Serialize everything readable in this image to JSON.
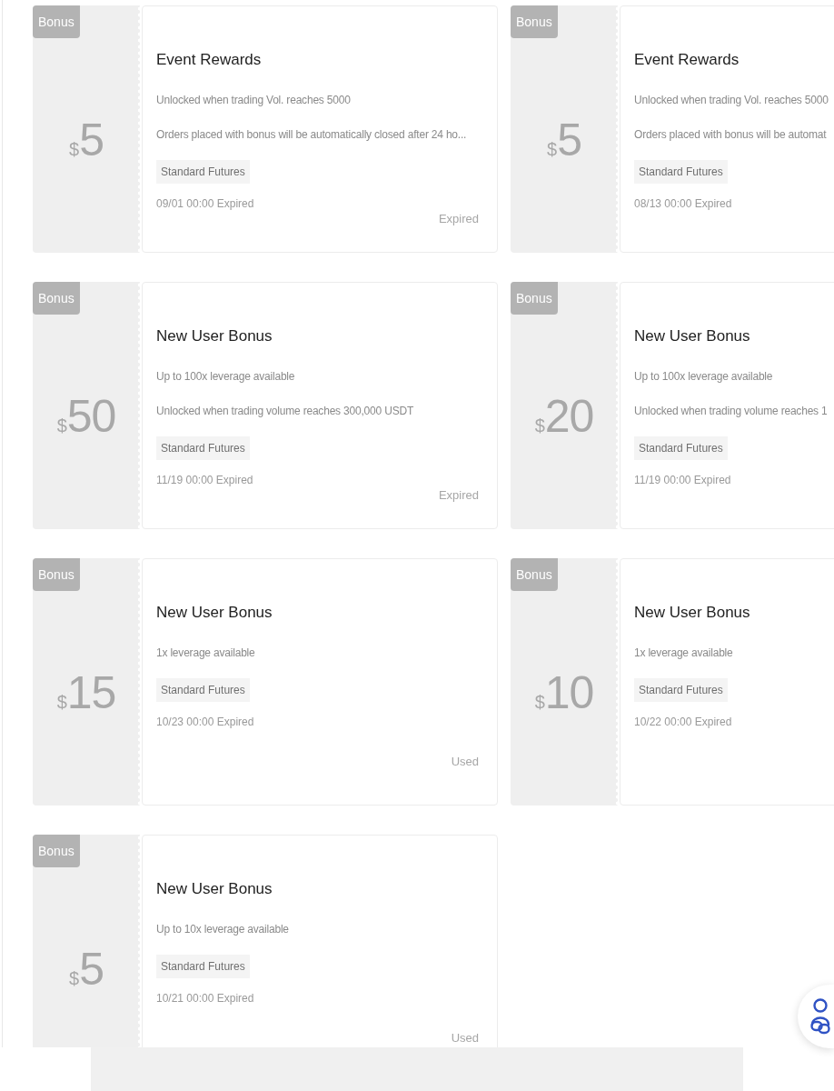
{
  "coupons": [
    {
      "badge": "Bonus",
      "currency": "$",
      "amount": "5",
      "title": "Event Rewards",
      "conditions": [
        "Unlocked when trading Vol. reaches 5000",
        "Orders placed with bonus will be automatically closed after 24 ho..."
      ],
      "tag": "Standard Futures",
      "expiry": "09/01 00:00 Expired",
      "status": "Expired"
    },
    {
      "badge": "Bonus",
      "currency": "$",
      "amount": "5",
      "title": "Event Rewards",
      "conditions": [
        "Unlocked when trading Vol. reaches 5000",
        "Orders placed with bonus will be automat"
      ],
      "tag": "Standard Futures",
      "expiry": "08/13 00:00 Expired"
    },
    {
      "badge": "Bonus",
      "currency": "$",
      "amount": "50",
      "title": "New User Bonus",
      "conditions": [
        "Up to 100x leverage available",
        "Unlocked when trading volume reaches 300,000 USDT"
      ],
      "tag": "Standard Futures",
      "expiry": "11/19 00:00 Expired",
      "status": "Expired"
    },
    {
      "badge": "Bonus",
      "currency": "$",
      "amount": "20",
      "title": "New User Bonus",
      "conditions": [
        "Up to 100x leverage available",
        "Unlocked when trading volume reaches 1"
      ],
      "tag": "Standard Futures",
      "expiry": "11/19 00:00 Expired"
    },
    {
      "badge": "Bonus",
      "currency": "$",
      "amount": "15",
      "title": "New User Bonus",
      "conditions": [
        "1x leverage available"
      ],
      "tag": "Standard Futures",
      "expiry": "10/23 00:00 Expired",
      "status": "Used"
    },
    {
      "badge": "Bonus",
      "currency": "$",
      "amount": "10",
      "title": "New User Bonus",
      "conditions": [
        "1x leverage available"
      ],
      "tag": "Standard Futures",
      "expiry": "10/22 00:00 Expired"
    },
    {
      "badge": "Bonus",
      "currency": "$",
      "amount": "5",
      "title": "New User Bonus",
      "conditions": [
        "Up to 10x leverage available"
      ],
      "tag": "Standard Futures",
      "expiry": "10/21 00:00 Expired",
      "status": "Used"
    }
  ]
}
